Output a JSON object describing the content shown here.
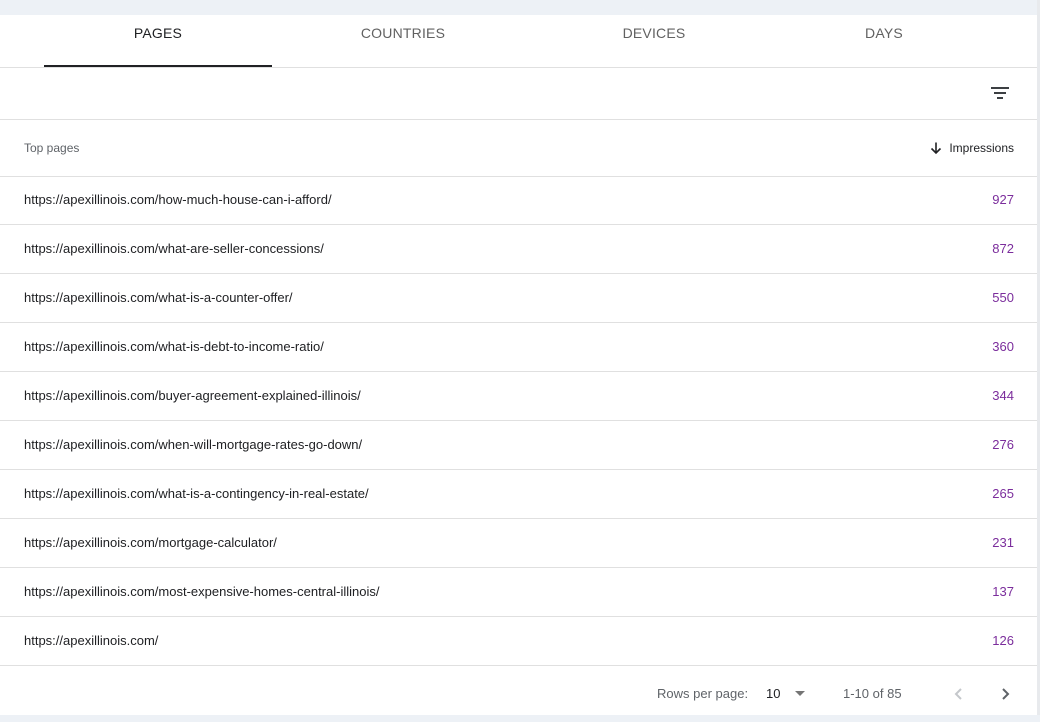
{
  "tabs": [
    {
      "label": "PAGES",
      "active": true
    },
    {
      "label": "COUNTRIES",
      "active": false
    },
    {
      "label": "DEVICES",
      "active": false
    },
    {
      "label": "DAYS",
      "active": false
    }
  ],
  "toolbar": {
    "filter_icon": "filter-list-icon"
  },
  "table": {
    "column_left": "Top pages",
    "column_right": "Impressions",
    "sort_icon": "arrow-downward-icon",
    "rows": [
      {
        "url": "https://apexillinois.com/how-much-house-can-i-afford/",
        "impressions": "927"
      },
      {
        "url": "https://apexillinois.com/what-are-seller-concessions/",
        "impressions": "872"
      },
      {
        "url": "https://apexillinois.com/what-is-a-counter-offer/",
        "impressions": "550"
      },
      {
        "url": "https://apexillinois.com/what-is-debt-to-income-ratio/",
        "impressions": "360"
      },
      {
        "url": "https://apexillinois.com/buyer-agreement-explained-illinois/",
        "impressions": "344"
      },
      {
        "url": "https://apexillinois.com/when-will-mortgage-rates-go-down/",
        "impressions": "276"
      },
      {
        "url": "https://apexillinois.com/what-is-a-contingency-in-real-estate/",
        "impressions": "265"
      },
      {
        "url": "https://apexillinois.com/mortgage-calculator/",
        "impressions": "231"
      },
      {
        "url": "https://apexillinois.com/most-expensive-homes-central-illinois/",
        "impressions": "137"
      },
      {
        "url": "https://apexillinois.com/",
        "impressions": "126"
      }
    ]
  },
  "pagination": {
    "rows_per_page_label": "Rows per page:",
    "rows_per_page_value": "10",
    "range_text": "1-10 of 85"
  },
  "colors": {
    "value_text": "#7b2d9c",
    "page_background": "#edf1f6"
  }
}
